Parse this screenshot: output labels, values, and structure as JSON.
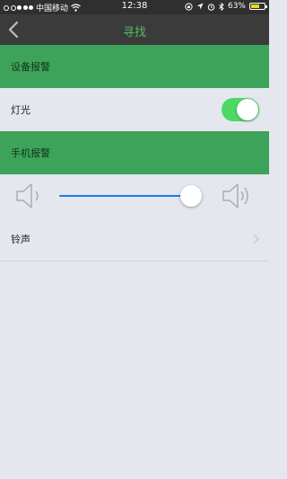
{
  "status_bar": {
    "carrier": "中国移动",
    "time": "12:38",
    "battery_percent": "63%",
    "battery_level": 0.63
  },
  "nav": {
    "title": "寻找",
    "title_color": "#4ec05f"
  },
  "sections": {
    "device_alarm": "设备报警",
    "phone_alarm": "手机报警"
  },
  "rows": {
    "light_label": "灯光",
    "light_on": true,
    "ringtone_label": "铃声"
  },
  "volume": {
    "level": 0.93
  },
  "colors": {
    "section_green": "#3ea35a",
    "toggle_on": "#4cd964",
    "slider_blue": "#1f7be6"
  }
}
